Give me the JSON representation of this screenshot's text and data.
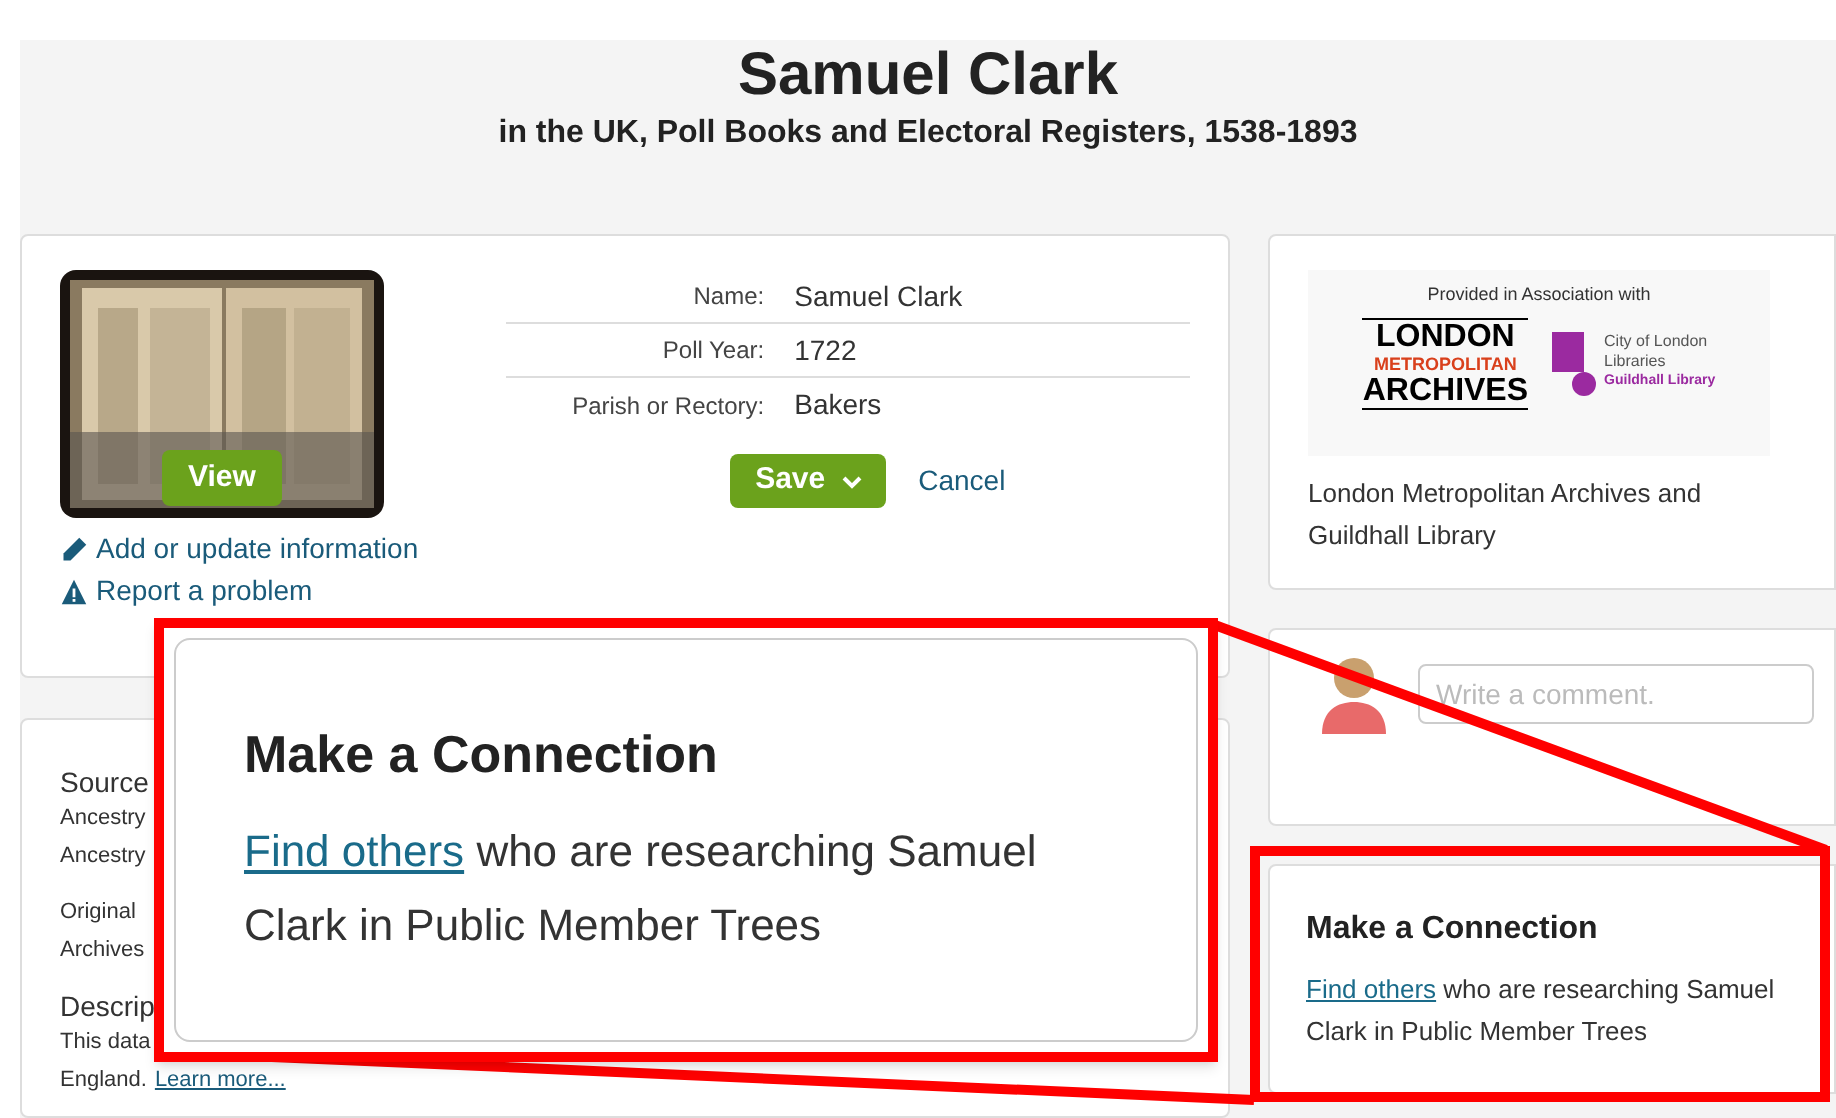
{
  "header": {
    "title": "Samuel Clark",
    "subtitle": "in the UK, Poll Books and Electoral Registers, 1538-1893"
  },
  "record": {
    "view_button": "View",
    "fields": [
      {
        "label": "Name:",
        "value": "Samuel Clark"
      },
      {
        "label": "Poll Year:",
        "value": "1722"
      },
      {
        "label": "Parish or Rectory:",
        "value": "Bakers"
      }
    ],
    "save_button": "Save",
    "cancel_link": "Cancel",
    "links": [
      {
        "kind": "edit",
        "label": "Add or update information"
      },
      {
        "kind": "warning",
        "label": "Report a problem"
      }
    ]
  },
  "source_card": {
    "lines": [
      {
        "kind": "heading",
        "text": "Source"
      },
      {
        "kind": "body",
        "text": "Ancestry"
      },
      {
        "kind": "body",
        "text": "Ancestry"
      },
      {
        "kind": "gap"
      },
      {
        "kind": "body",
        "text": "Original"
      },
      {
        "kind": "body",
        "text": "Archives"
      },
      {
        "kind": "gap"
      },
      {
        "kind": "heading",
        "text": "Descrip"
      },
      {
        "kind": "body",
        "text": "This data"
      },
      {
        "kind": "body",
        "text": "England.",
        "link": "Learn more..."
      }
    ]
  },
  "provider": {
    "caption": "Provided in Association with",
    "logo_lines": [
      "LONDON",
      "METROPOLITAN",
      "ARCHIVES"
    ],
    "partner_lines": [
      "City of London",
      "Libraries",
      "Guildhall Library"
    ],
    "name": "London Metropolitan Archives and Guildhall Library"
  },
  "comment": {
    "placeholder": "Write a comment."
  },
  "connection": {
    "title": "Make a Connection",
    "link": "Find others",
    "text": "who are researching Samuel Clark in Public Member Trees"
  },
  "callout": {
    "title": "Make a Connection",
    "link": "Find others",
    "text": "who are researching Samuel Clark in Public Member Trees"
  }
}
